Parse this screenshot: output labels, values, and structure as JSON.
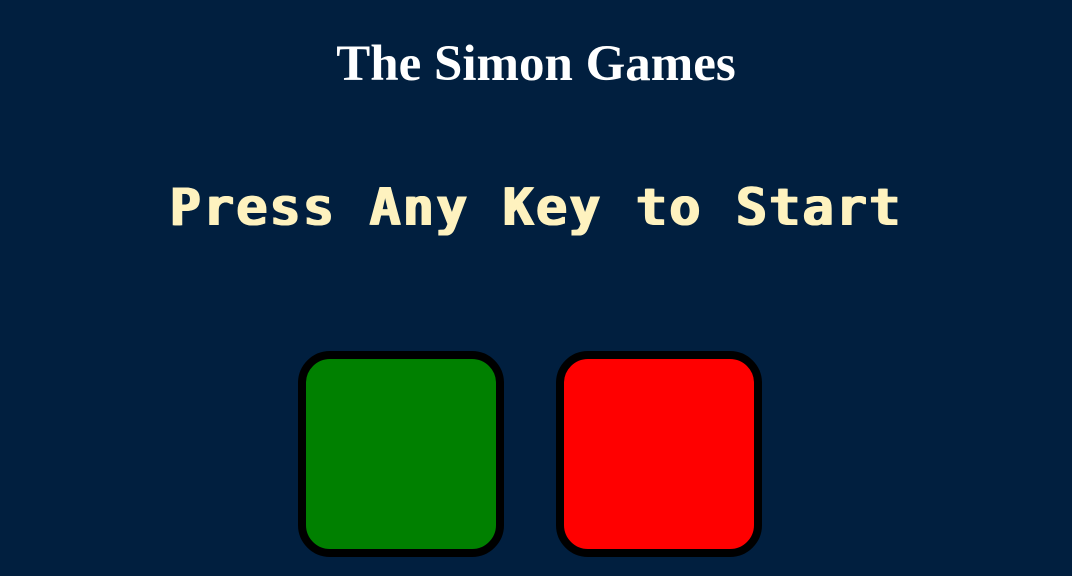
{
  "header": {
    "title": "The Simon Games"
  },
  "level": {
    "text": "Press Any Key to Start"
  },
  "buttons": [
    {
      "id": "green",
      "color": "#008000"
    },
    {
      "id": "red",
      "color": "#FF0000"
    }
  ],
  "colors": {
    "background": "#011F3F",
    "title": "#FFFFFF",
    "level_text": "#FEF2BF",
    "button_border": "#000000"
  }
}
